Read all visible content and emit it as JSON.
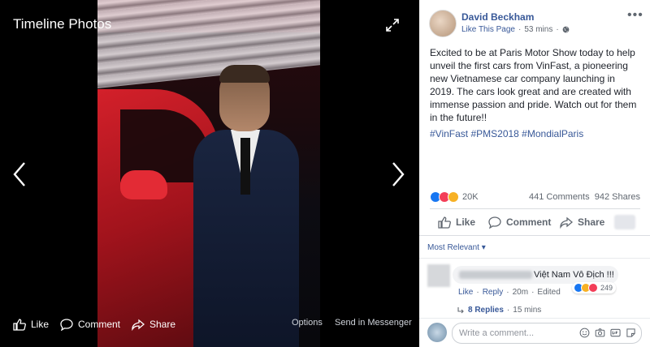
{
  "viewer": {
    "title": "Timeline Photos",
    "actions": {
      "like": "Like",
      "comment": "Comment",
      "share": "Share"
    },
    "options": "Options",
    "send": "Send in Messenger",
    "icons": [
      "expand-icon",
      "prev-arrow-icon",
      "next-arrow-icon",
      "like-icon",
      "comment-icon",
      "share-icon"
    ]
  },
  "post": {
    "author": "David Beckham",
    "like_page": "Like This Page",
    "separator": "·",
    "time": "53 mins",
    "separator2": "·",
    "text": "Excited to be at Paris Motor Show today to help unveil the first cars from VinFast, a pioneering new Vietnamese car company launching in 2019. The cars look great and are created with immense passion and pride. Watch out for them in the future!!",
    "hashtags": "#VinFast #PMS2018 #MondialParis",
    "reactions_count": "20K",
    "comments_count": "441 Comments",
    "shares_count": "942 Shares",
    "actions": {
      "like": "Like",
      "comment": "Comment",
      "share": "Share"
    }
  },
  "comments": {
    "sort": "Most Relevant",
    "items": [
      {
        "text": "Việt Nam Vô Địch !!!",
        "like": "Like",
        "dot1": "·",
        "reply": "Reply",
        "dot2": "·",
        "time": "20m",
        "dot3": "·",
        "edited": "Edited",
        "reactions": "249",
        "replies": "8 Replies",
        "dot4": "·",
        "replies_time": "15 mins"
      }
    ],
    "write_placeholder": "Write a comment..."
  },
  "colors": {
    "link": "#385898",
    "like_blue": "#1877f2",
    "love_red": "#f33e58",
    "wow_yellow": "#f7b125"
  }
}
